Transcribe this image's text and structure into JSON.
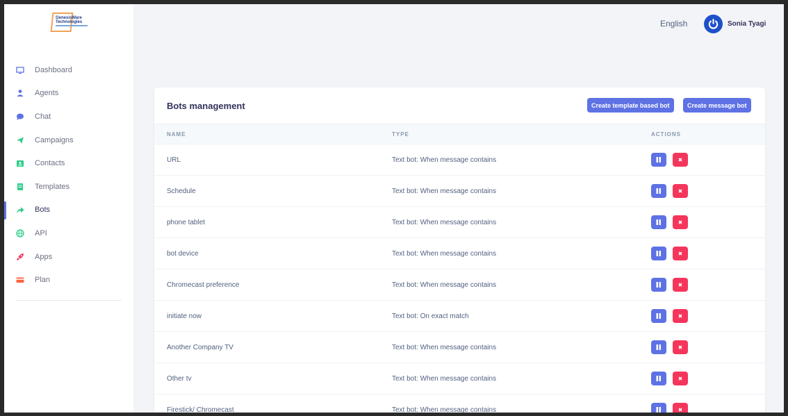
{
  "brand": {
    "logo_line1": "GenesisWare",
    "logo_line2": "Technologies"
  },
  "sidebar": {
    "items": [
      {
        "label": "Dashboard",
        "icon": "monitor-icon",
        "color": "#5e72e4"
      },
      {
        "label": "Agents",
        "icon": "user-icon",
        "color": "#5e72e4"
      },
      {
        "label": "Chat",
        "icon": "chat-bubble-icon",
        "color": "#5e72e4"
      },
      {
        "label": "Campaigns",
        "icon": "paper-plane-icon",
        "color": "#2dce89"
      },
      {
        "label": "Contacts",
        "icon": "contact-card-icon",
        "color": "#2dce89"
      },
      {
        "label": "Templates",
        "icon": "document-icon",
        "color": "#2dce89"
      },
      {
        "label": "Bots",
        "icon": "share-arrow-icon",
        "color": "#2dce89",
        "active": true
      },
      {
        "label": "API",
        "icon": "globe-icon",
        "color": "#2dce89"
      },
      {
        "label": "Apps",
        "icon": "rocket-icon",
        "color": "#f5365c"
      },
      {
        "label": "Plan",
        "icon": "credit-card-icon",
        "color": "#fb6340"
      }
    ]
  },
  "header": {
    "language": "English",
    "user_name": "Sonia Tyagi"
  },
  "bots": {
    "title": "Bots management",
    "create_template_label": "Create template based bot",
    "create_message_label": "Create message bot",
    "columns": [
      "NAME",
      "TYPE",
      "ACTIONS"
    ],
    "rows": [
      {
        "name": "URL",
        "type": "Text bot: When message contains"
      },
      {
        "name": "Schedule",
        "type": "Text bot: When message contains"
      },
      {
        "name": "phone tablet",
        "type": "Text bot: When message contains"
      },
      {
        "name": "bot device",
        "type": "Text bot: When message contains"
      },
      {
        "name": "Chromecast preference",
        "type": "Text bot: When message contains"
      },
      {
        "name": "initiate now",
        "type": "Text bot: On exact match"
      },
      {
        "name": "Another Company TV",
        "type": "Text bot: When message contains"
      },
      {
        "name": "Other tv",
        "type": "Text bot: When message contains"
      },
      {
        "name": "Firestick/ Chromecast",
        "type": "Text bot: When message contains"
      }
    ]
  },
  "colors": {
    "primary": "#5e72e4",
    "danger": "#f5365c"
  }
}
